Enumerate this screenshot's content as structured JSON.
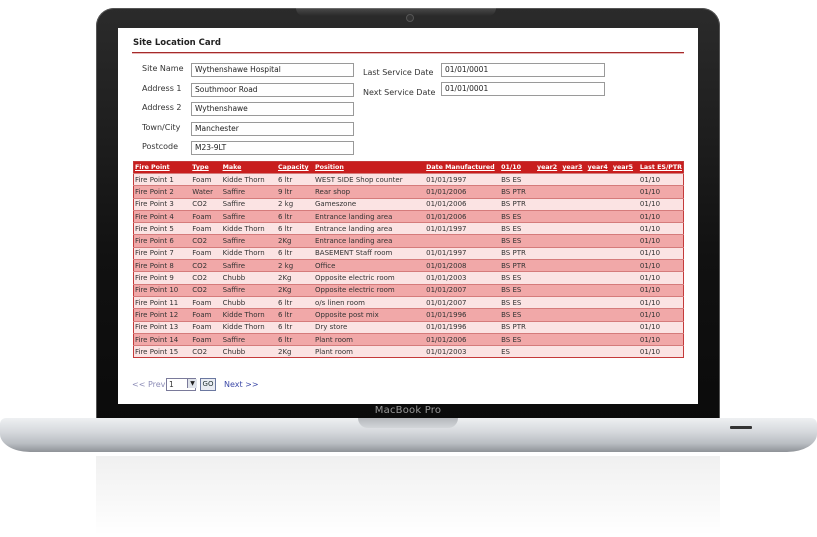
{
  "device": {
    "model": "MacBook Pro"
  },
  "card": {
    "title": "Site Location Card",
    "fields": {
      "site_name": {
        "label": "Site Name",
        "value": "Wythenshawe Hospital"
      },
      "address1": {
        "label": "Address 1",
        "value": "Southmoor Road"
      },
      "address2": {
        "label": "Address 2",
        "value": "Wythenshawe"
      },
      "town": {
        "label": "Town/City",
        "value": "Manchester"
      },
      "postcode": {
        "label": "Postcode",
        "value": "M23-9LT"
      },
      "last_service": {
        "label": "Last Service Date",
        "value": "01/01/0001"
      },
      "next_service": {
        "label": "Next Service Date",
        "value": "01/01/0001"
      }
    }
  },
  "table": {
    "headers": [
      "Fire Point",
      "Type",
      "Make",
      "Capacity",
      "Position",
      "Date Manufactured",
      "01/10",
      "year2",
      "year3",
      "year4",
      "year5",
      "Last ES/PTR"
    ],
    "rows": [
      [
        "Fire Point 1",
        "Foam",
        "Kidde Thorn",
        "6 ltr",
        "WEST SIDE Shop counter",
        "01/01/1997",
        "BS ES",
        "",
        "",
        "",
        "",
        "01/10"
      ],
      [
        "Fire Point 2",
        "Water",
        "Saffire",
        "9 ltr",
        "Rear shop",
        "01/01/2006",
        "BS PTR",
        "",
        "",
        "",
        "",
        "01/10"
      ],
      [
        "Fire Point 3",
        "CO2",
        "Saffire",
        "2 kg",
        "Gameszone",
        "01/01/2006",
        "BS PTR",
        "",
        "",
        "",
        "",
        "01/10"
      ],
      [
        "Fire Point 4",
        "Foam",
        "Saffire",
        "6 ltr",
        "Entrance landing area",
        "01/01/2006",
        "BS ES",
        "",
        "",
        "",
        "",
        "01/10"
      ],
      [
        "Fire Point 5",
        "Foam",
        "Kidde Thorn",
        "6 ltr",
        "Entrance landing area",
        "01/01/1997",
        "BS ES",
        "",
        "",
        "",
        "",
        "01/10"
      ],
      [
        "Fire Point 6",
        "CO2",
        "Saffire",
        "2Kg",
        "Entrance landing area",
        "",
        "BS ES",
        "",
        "",
        "",
        "",
        "01/10"
      ],
      [
        "Fire Point 7",
        "Foam",
        "Kidde Thorn",
        "6 ltr",
        "BASEMENT Staff room",
        "01/01/1997",
        "BS PTR",
        "",
        "",
        "",
        "",
        "01/10"
      ],
      [
        "Fire Point 8",
        "CO2",
        "Saffire",
        "2 kg",
        "Office",
        "01/01/2008",
        "BS PTR",
        "",
        "",
        "",
        "",
        "01/10"
      ],
      [
        "Fire Point 9",
        "CO2",
        "Chubb",
        "2Kg",
        "Opposite electric room",
        "01/01/2003",
        "BS ES",
        "",
        "",
        "",
        "",
        "01/10"
      ],
      [
        "Fire Point 10",
        "CO2",
        "Saffire",
        "2Kg",
        "Opposite electric room",
        "01/01/2007",
        "BS ES",
        "",
        "",
        "",
        "",
        "01/10"
      ],
      [
        "Fire Point 11",
        "Foam",
        "Chubb",
        "6 ltr",
        "o/s linen room",
        "01/01/2007",
        "BS ES",
        "",
        "",
        "",
        "",
        "01/10"
      ],
      [
        "Fire Point 12",
        "Foam",
        "Kidde Thorn",
        "6 ltr",
        "Opposite post mix",
        "01/01/1996",
        "BS ES",
        "",
        "",
        "",
        "",
        "01/10"
      ],
      [
        "Fire Point 13",
        "Foam",
        "Kidde Thorn",
        "6 ltr",
        "Dry store",
        "01/01/1996",
        "BS PTR",
        "",
        "",
        "",
        "",
        "01/10"
      ],
      [
        "Fire Point 14",
        "Foam",
        "Saffire",
        "6 ltr",
        "Plant room",
        "01/01/2006",
        "BS ES",
        "",
        "",
        "",
        "",
        "01/10"
      ],
      [
        "Fire Point 15",
        "CO2",
        "Chubb",
        "2Kg",
        "Plant room",
        "01/01/2003",
        "ES",
        "",
        "",
        "",
        "",
        "01/10"
      ]
    ]
  },
  "pager": {
    "prev": "<< Prev",
    "page": "1",
    "go": "GO",
    "next": "Next >>"
  },
  "colors": {
    "header_red": "#c81e1e",
    "row_light": "#fbe3e3",
    "row_dark": "#f1a8a8"
  }
}
